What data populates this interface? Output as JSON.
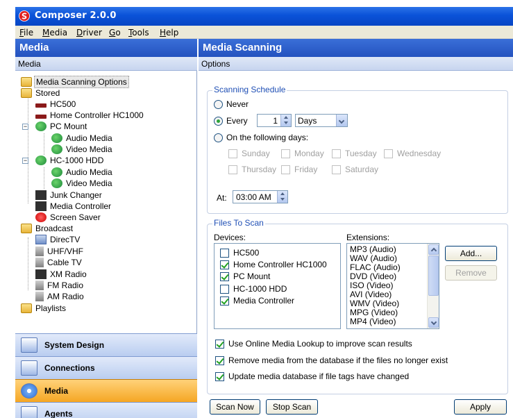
{
  "window": {
    "title": "Composer 2.0.0"
  },
  "menu": [
    "File",
    "Media",
    "Driver",
    "Go",
    "Tools",
    "Help"
  ],
  "left": {
    "header": "Media",
    "subheader": "Media",
    "tree": [
      "Media Scanning Options",
      "Stored",
      "HC500",
      "Home Controller HC1000",
      "PC Mount",
      "Audio Media",
      "Video Media",
      "HC-1000 HDD",
      "Audio Media",
      "Video Media",
      "Junk Changer",
      "Media Controller",
      "Screen Saver",
      "Broadcast",
      "DirecTV",
      "UHF/VHF",
      "Cable TV",
      "XM Radio",
      "FM Radio",
      "AM Radio",
      "Playlists"
    ],
    "nav": [
      "System Design",
      "Connections",
      "Media",
      "Agents"
    ]
  },
  "right": {
    "header": "Media Scanning",
    "subheader": "Options",
    "schedule": {
      "legend": "Scanning Schedule",
      "never": "Never",
      "every": "Every",
      "every_value": "1",
      "unit": "Days",
      "following": "On the following days:",
      "days": [
        "Sunday",
        "Monday",
        "Tuesday",
        "Wednesday",
        "Thursday",
        "Friday",
        "Saturday"
      ],
      "at_label": "At:",
      "at_value": "03:00 AM"
    },
    "files": {
      "legend": "Files To Scan",
      "devices_label": "Devices:",
      "extensions_label": "Extensions:",
      "devices": [
        {
          "name": "HC500",
          "checked": false
        },
        {
          "name": "Home Controller HC1000",
          "checked": true
        },
        {
          "name": "PC Mount",
          "checked": true
        },
        {
          "name": "HC-1000 HDD",
          "checked": false
        },
        {
          "name": "Media Controller",
          "checked": true
        }
      ],
      "extensions": [
        "MP3 (Audio)",
        "WAV (Audio)",
        "FLAC (Audio)",
        "DVD (Video)",
        "ISO (Video)",
        "AVI (Video)",
        "WMV (Video)",
        "MPG (Video)",
        "MP4 (Video)"
      ],
      "add": "Add...",
      "remove": "Remove"
    },
    "options": [
      "Use Online Media Lookup to improve scan results",
      "Remove media from the database if the files no longer exist",
      "Update media database if file tags have changed"
    ],
    "buttons": {
      "scan_now": "Scan Now",
      "stop_scan": "Stop Scan",
      "apply": "Apply"
    }
  }
}
